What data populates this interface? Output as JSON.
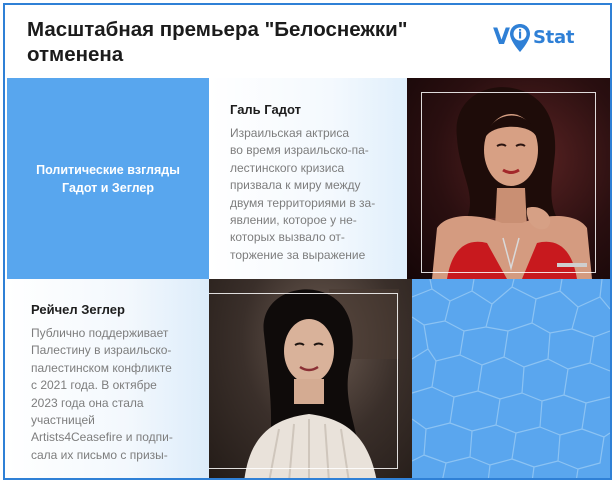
{
  "header": {
    "title": "Масштабная премьера \"Белоснежки\" отменена",
    "logo_left": "V",
    "logo_pin_letter": "i",
    "logo_right": "Stat"
  },
  "topic": "Политические взгляды Гадот и Зеглер",
  "gal": {
    "name": "Галь Гадот",
    "description_lines": [
      "Израильская актриса",
      "во время израильско-па-",
      "лестинского кризиса",
      "призвала к миру между",
      "двумя территориями в за-",
      "явлении, которое у не-",
      "которых вызвало от-",
      "торжение за выражение"
    ]
  },
  "rachel": {
    "name": "Рейчел Зеглер",
    "description_lines": [
      "Публично поддерживает",
      "Палестину в израильско-",
      "палестинском конфликте",
      "с 2021 года. В октябре",
      "2023 года она стала",
      "участницей",
      "Artists4Ceasefire и подпи-",
      "сала их письмо с призы-"
    ]
  },
  "colors": {
    "accent_blue": "#58a6ee",
    "logo_blue": "#2f80d6",
    "gal_dress_red": "#c8191e"
  },
  "icons": {
    "logo_pin": "map-pin-icon"
  }
}
